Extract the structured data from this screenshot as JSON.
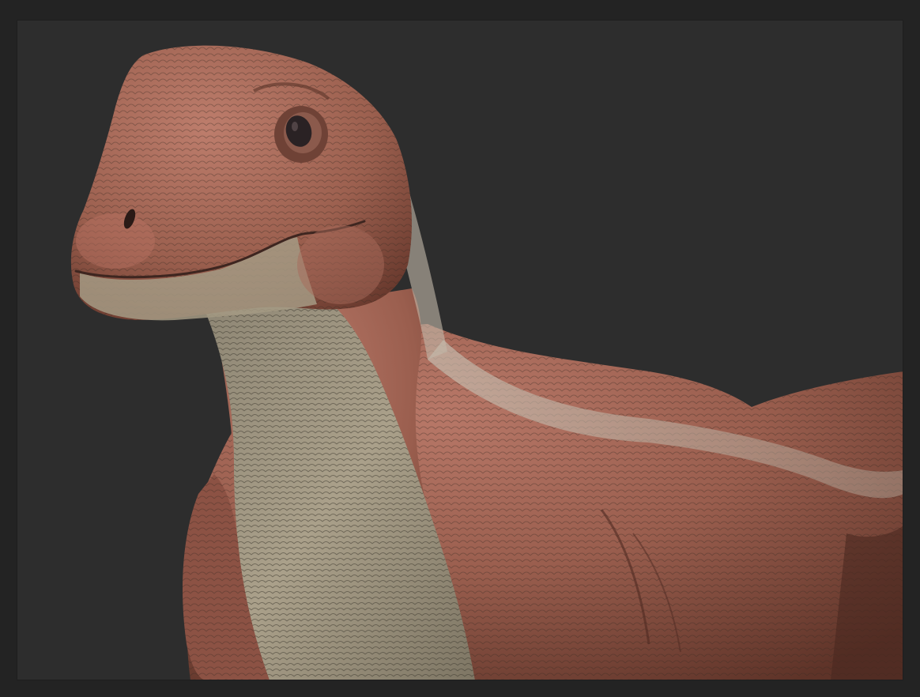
{
  "scene": {
    "subject_icon": "dinosaur-sculpt-icon",
    "colors": {
      "frame": "#232323",
      "viewport_background": "#2d2d2d",
      "skin_primary": "#9a5e4e",
      "skin_shadow": "#5e3328",
      "skin_highlight": "#b8786a",
      "belly": "#a49a84",
      "stripe": "#bdb3a4",
      "eye": "#2a2224"
    }
  }
}
